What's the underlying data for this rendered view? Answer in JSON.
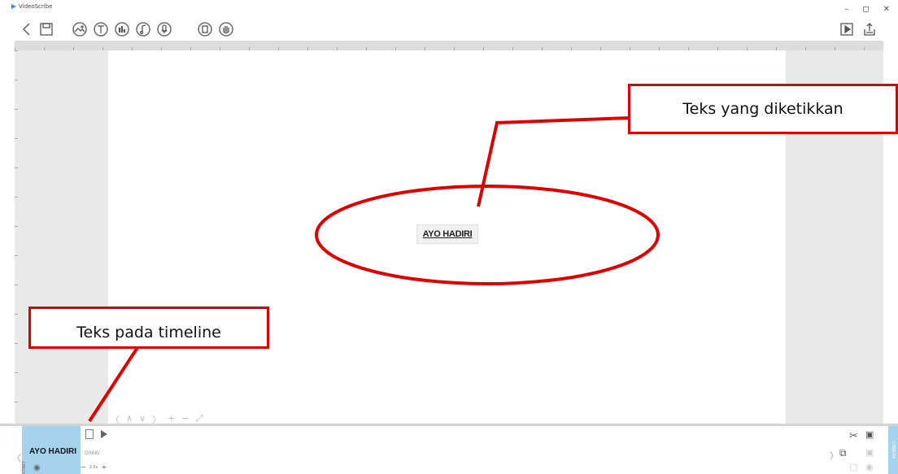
{
  "window": {
    "title": "VideoScribe",
    "controls": [
      "–",
      "◻",
      "✕"
    ]
  },
  "toolbar": {
    "left_icons": [
      "back-icon",
      "save-icon",
      "image-icon",
      "text-icon",
      "chart-icon",
      "music-icon",
      "voiceover-icon",
      "background-icon",
      "hand-icon"
    ],
    "right_icons": [
      "preview-icon",
      "share-icon"
    ]
  },
  "canvas": {
    "element_text": "AYO HADIRI",
    "nav": [
      "〈",
      "∧",
      "∨",
      "〉",
      "+",
      "−",
      "⤢"
    ]
  },
  "timeline": {
    "element_label": "AYO HADIRI",
    "side_label": "START",
    "mode": "DRAW",
    "zoom_value": "2.5x",
    "zoom_minus": "−",
    "zoom_plus": "+",
    "prev": "〈",
    "next": "〉",
    "side_tab": "CAMERA"
  },
  "annotations": {
    "callout_1": "Teks yang diketikkan",
    "callout_2": "Teks pada timeline"
  },
  "colors": {
    "annotation_red": "#e00000",
    "timeline_element": "#a6d2ec",
    "workspace_gray": "#e9e9e9"
  }
}
